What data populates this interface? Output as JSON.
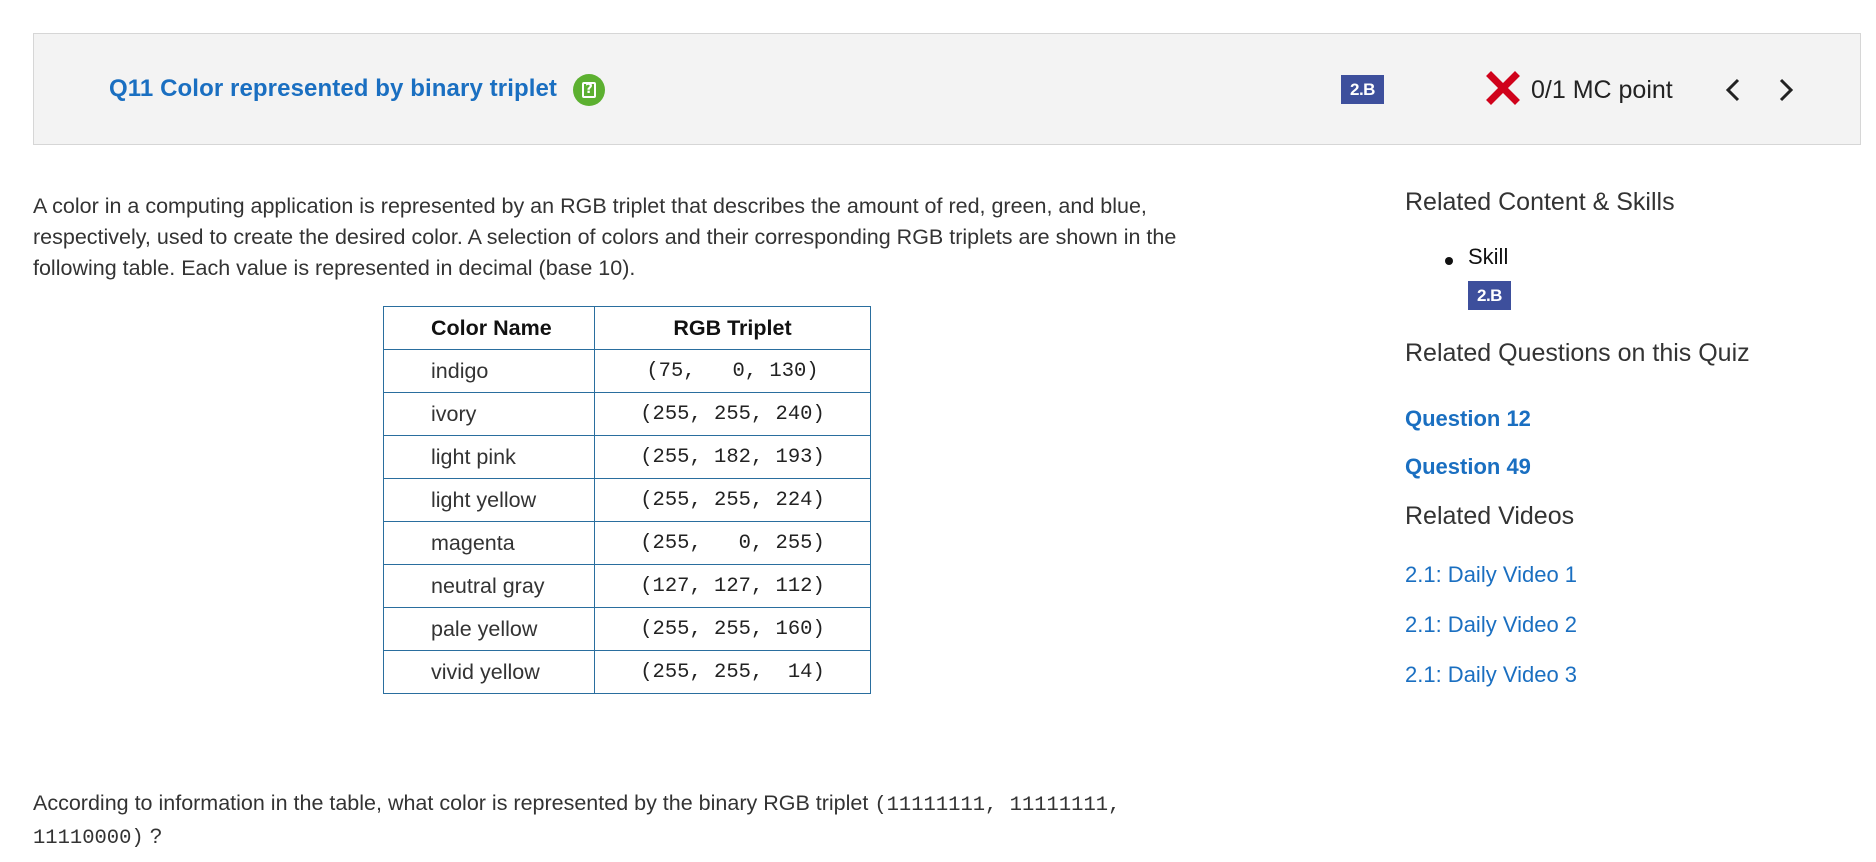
{
  "header": {
    "question_title": "Q11 Color represented by binary triplet",
    "help_icon": "help-icon",
    "skill_badge": "2.B",
    "score_icon": "incorrect-x-icon",
    "score_text": "0/1 MC point",
    "prev_icon": "chevron-left-icon",
    "next_icon": "chevron-right-icon"
  },
  "stem": {
    "paragraph": "A color in a computing application is represented by an RGB triplet that describes the amount of red, green, and blue, respectively, used to create the desired color. A selection of colors and their corresponding RGB triplets are shown in the following table. Each value is represented in decimal (base 10)."
  },
  "table": {
    "headers": [
      "Color Name",
      "RGB Triplet"
    ],
    "rows": [
      {
        "name": "indigo",
        "rgb": "(75,   0, 130)"
      },
      {
        "name": "ivory",
        "rgb": "(255, 255, 240)"
      },
      {
        "name": "light pink",
        "rgb": "(255, 182, 193)"
      },
      {
        "name": "light yellow",
        "rgb": "(255, 255, 224)"
      },
      {
        "name": "magenta",
        "rgb": "(255,   0, 255)"
      },
      {
        "name": "neutral gray",
        "rgb": "(127, 127, 112)"
      },
      {
        "name": "pale yellow",
        "rgb": "(255, 255, 160)"
      },
      {
        "name": "vivid yellow",
        "rgb": "(255, 255,  14)"
      }
    ]
  },
  "question": {
    "prefix": "According to information in the table, what color is represented by the binary RGB triplet ",
    "triplet": "(11111111, 11111111, 11110000)",
    "suffix": "?"
  },
  "sidebar": {
    "related_heading": "Related Content & Skills",
    "skill_label": "Skill",
    "skill_badge": "2.B",
    "questions_heading": "Related Questions on this Quiz",
    "questions": [
      "Question 12",
      "Question 49"
    ],
    "videos_heading": "Related Videos",
    "videos": [
      "2.1: Daily Video 1",
      "2.1: Daily Video 2",
      "2.1: Daily Video 3"
    ]
  },
  "colors": {
    "link": "#1a6fc1",
    "badge": "#3d4f9c",
    "help_green": "#5cb030",
    "incorrect_red": "#d0021b",
    "table_border": "#2a6e9e"
  }
}
